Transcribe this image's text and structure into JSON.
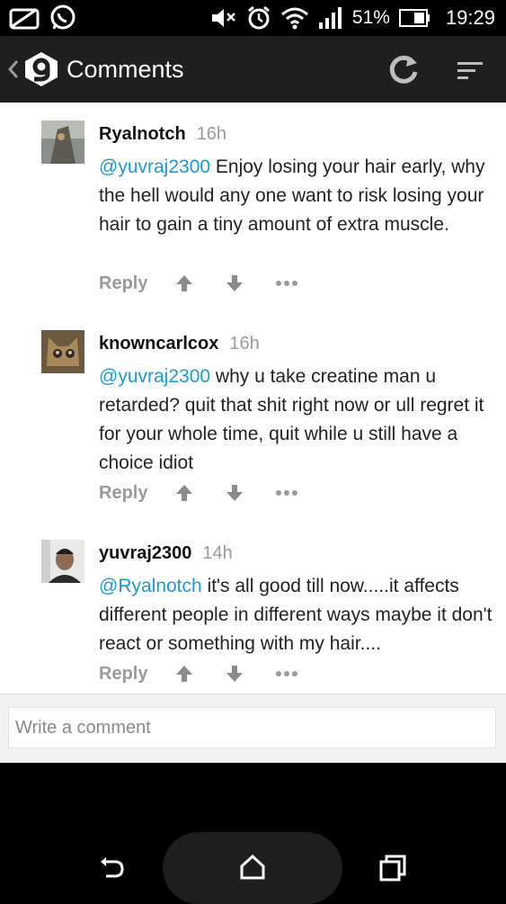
{
  "status_bar": {
    "battery": "51%",
    "time": "19:29",
    "icons": [
      "notification-icon",
      "whatsapp-icon",
      "mute-icon",
      "alarm-icon",
      "wifi-icon",
      "signal-icon",
      "battery-icon"
    ]
  },
  "app_bar": {
    "title": "Comments",
    "icons": [
      "back-chevron-icon",
      "app-logo-icon",
      "refresh-icon",
      "sort-icon"
    ]
  },
  "comments": [
    {
      "username": "Ryalnotch",
      "time": "16h",
      "mention": "@yuvraj2300",
      "text": " Enjoy losing your hair early, why the hell would any one want to risk losing your hair to gain a tiny amount of extra muscle.",
      "reply_label": "Reply"
    },
    {
      "username": "knowncarlcox",
      "time": "16h",
      "mention": "@yuvraj2300",
      "text": " why u take creatine man u retarded? quit that shit right now or ull regret it for your whole time, quit while u still have a choice idiot",
      "reply_label": "Reply"
    },
    {
      "username": "yuvraj2300",
      "time": "14h",
      "mention": "@Ryalnotch",
      "text": " it's all good till now.....it affects different people in different ways maybe it don't react or something with my hair....",
      "reply_label": "Reply"
    }
  ],
  "composer": {
    "placeholder": "Write a comment"
  },
  "nav_bar": {
    "icons": [
      "back-icon",
      "home-icon",
      "recent-apps-icon"
    ]
  },
  "colors": {
    "mention": "#1a9ad6",
    "app_bar": "#1f1f1f",
    "muted_text": "#9a9a9a"
  }
}
